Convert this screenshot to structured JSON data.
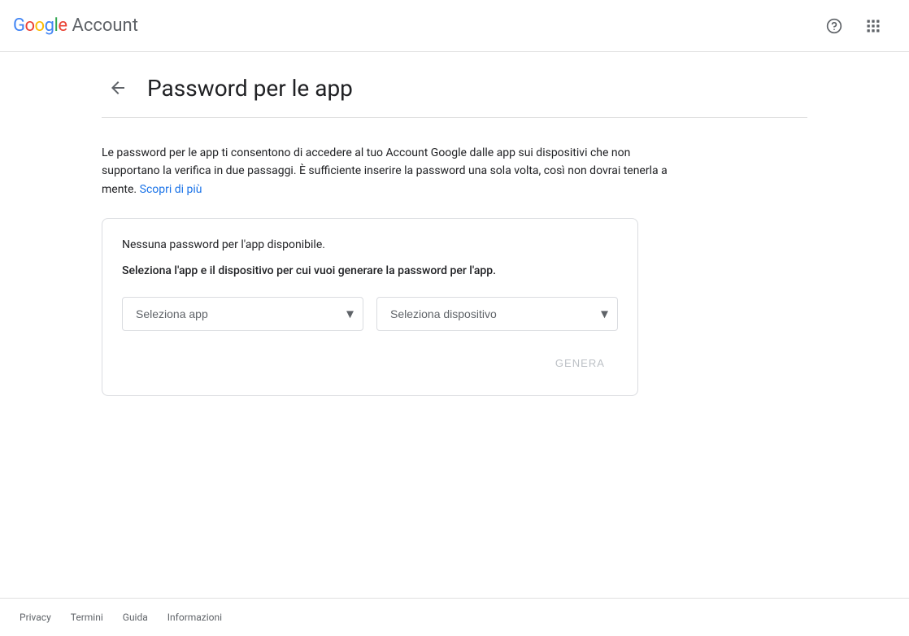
{
  "header": {
    "logo": {
      "google": "Google",
      "account": "Account"
    },
    "help_icon": "?",
    "apps_icon": "apps"
  },
  "page": {
    "back_label": "←",
    "title": "Password per le app",
    "description": "Le password per le app ti consentono di accedere al tuo Account Google dalle app sui dispositivi che non supportano la verifica in due passaggi. È sufficiente inserire la password una sola volta, così non dovrai tenerla a mente.",
    "learn_more": "Scopri di più",
    "card": {
      "no_password_text": "Nessuna password per l'app disponibile.",
      "select_instruction": "Seleziona l'app e il dispositivo per cui vuoi generare la password per l'app.",
      "app_dropdown_placeholder": "Seleziona app",
      "device_dropdown_placeholder": "Seleziona dispositivo",
      "genera_button": "GENERA"
    }
  },
  "footer": {
    "links": [
      {
        "label": "Privacy"
      },
      {
        "label": "Termini"
      },
      {
        "label": "Guida"
      },
      {
        "label": "Informazioni"
      }
    ]
  }
}
